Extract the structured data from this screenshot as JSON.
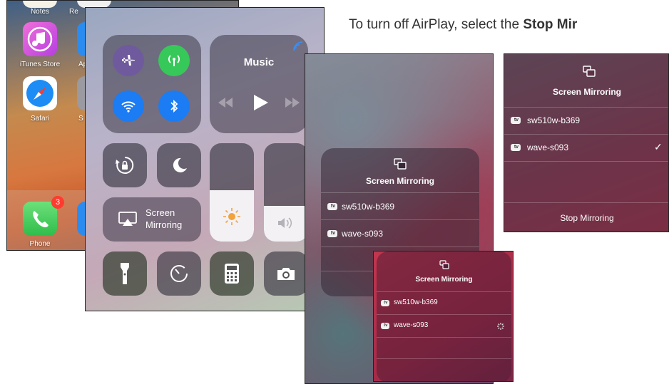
{
  "instruction": {
    "text_before": "To turn off AirPlay, select the ",
    "text_bold": "Stop Mir"
  },
  "home": {
    "apps_top": [
      "Notes",
      "Re"
    ],
    "apps_row2": [
      "iTunes Store",
      "Ap"
    ],
    "apps_row3": [
      "Safari",
      "S"
    ],
    "dock_phone": "Phone",
    "phone_badge": "3"
  },
  "control_center": {
    "music_title": "Music",
    "screen_mirroring_line1": "Screen",
    "screen_mirroring_line2": "Mirroring"
  },
  "mirroring_panels": {
    "title": "Screen Mirroring",
    "tv_badge": " tv",
    "device_1": "sw510w-b369",
    "device_2": "wave-s093",
    "checkmark": "✓",
    "stop_button": "Stop Mirroring"
  },
  "colors": {
    "airplane": "#6f5a9d",
    "cellular": "#37c85a",
    "wifi": "#1b7cf3",
    "bluetooth": "#1b7cf3",
    "badge_red": "#ff3b30"
  }
}
